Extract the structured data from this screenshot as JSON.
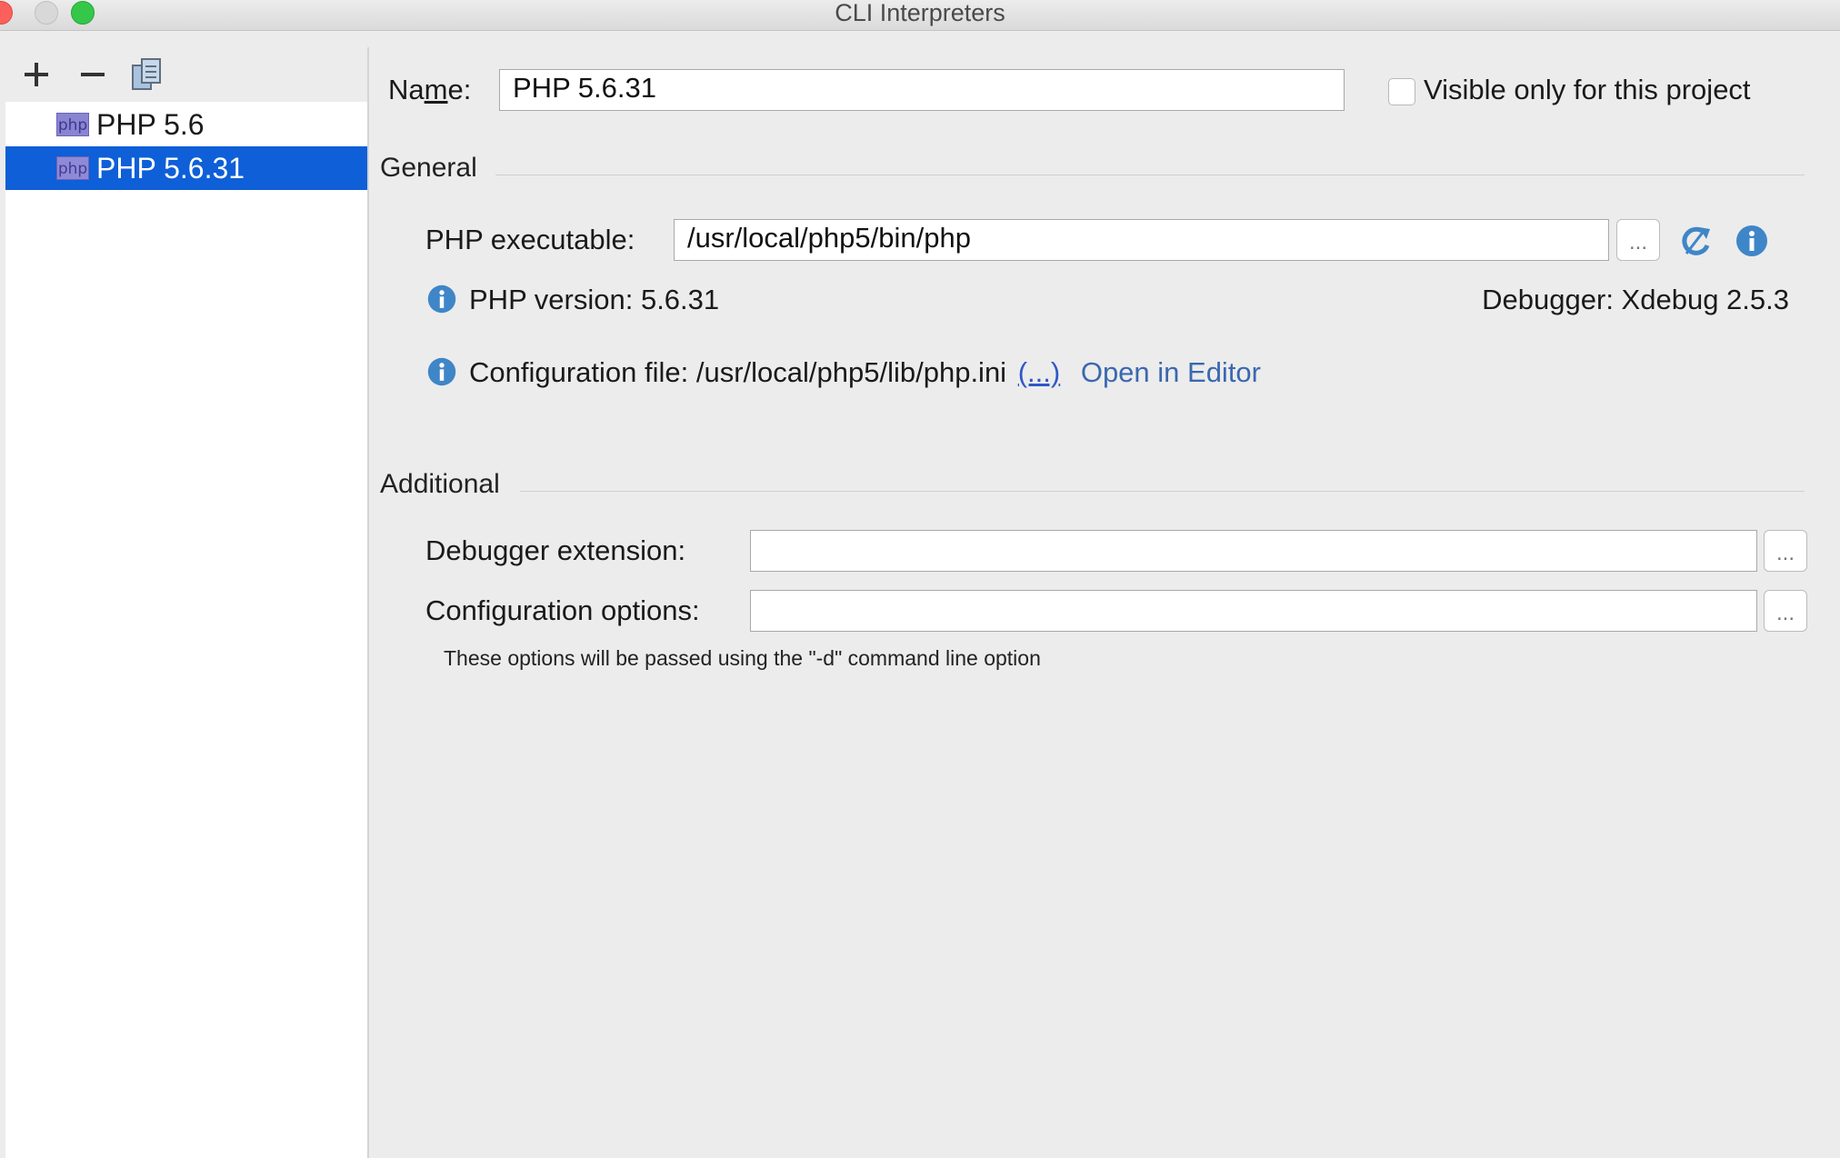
{
  "window": {
    "title": "CLI Interpreters"
  },
  "toolbar": {
    "add": "+",
    "remove": "−"
  },
  "interpreters": [
    {
      "icon": "php",
      "label": "PHP 5.6",
      "selected": false
    },
    {
      "icon": "php",
      "label": "PHP 5.6.31",
      "selected": true
    }
  ],
  "name_field": {
    "label_pre": "Na",
    "label_underlined": "m",
    "label_post": "e:",
    "value": "PHP 5.6.31"
  },
  "visible_only": {
    "label": "Visible only for this project",
    "checked": false
  },
  "general": {
    "title": "General",
    "executable_label": "PHP executable:",
    "executable_value": "/usr/local/php5/bin/php",
    "browse": "...",
    "php_version_text": "PHP version: 5.6.31",
    "debugger_text": "Debugger: Xdebug 2.5.3",
    "config_file_text": "Configuration file: /usr/local/php5/lib/php.ini",
    "config_file_more": "(...)",
    "open_in_editor": "Open in Editor"
  },
  "additional": {
    "title": "Additional",
    "debugger_extension_label": "Debugger extension:",
    "debugger_extension_value": "",
    "config_options_label": "Configuration options:",
    "config_options_value": "",
    "browse": "...",
    "hint": "These options will be passed using the \"-d\" command line option"
  },
  "colors": {
    "selection": "#0e5fd8",
    "link": "#2f57c7",
    "info_icon": "#3f86c8"
  }
}
